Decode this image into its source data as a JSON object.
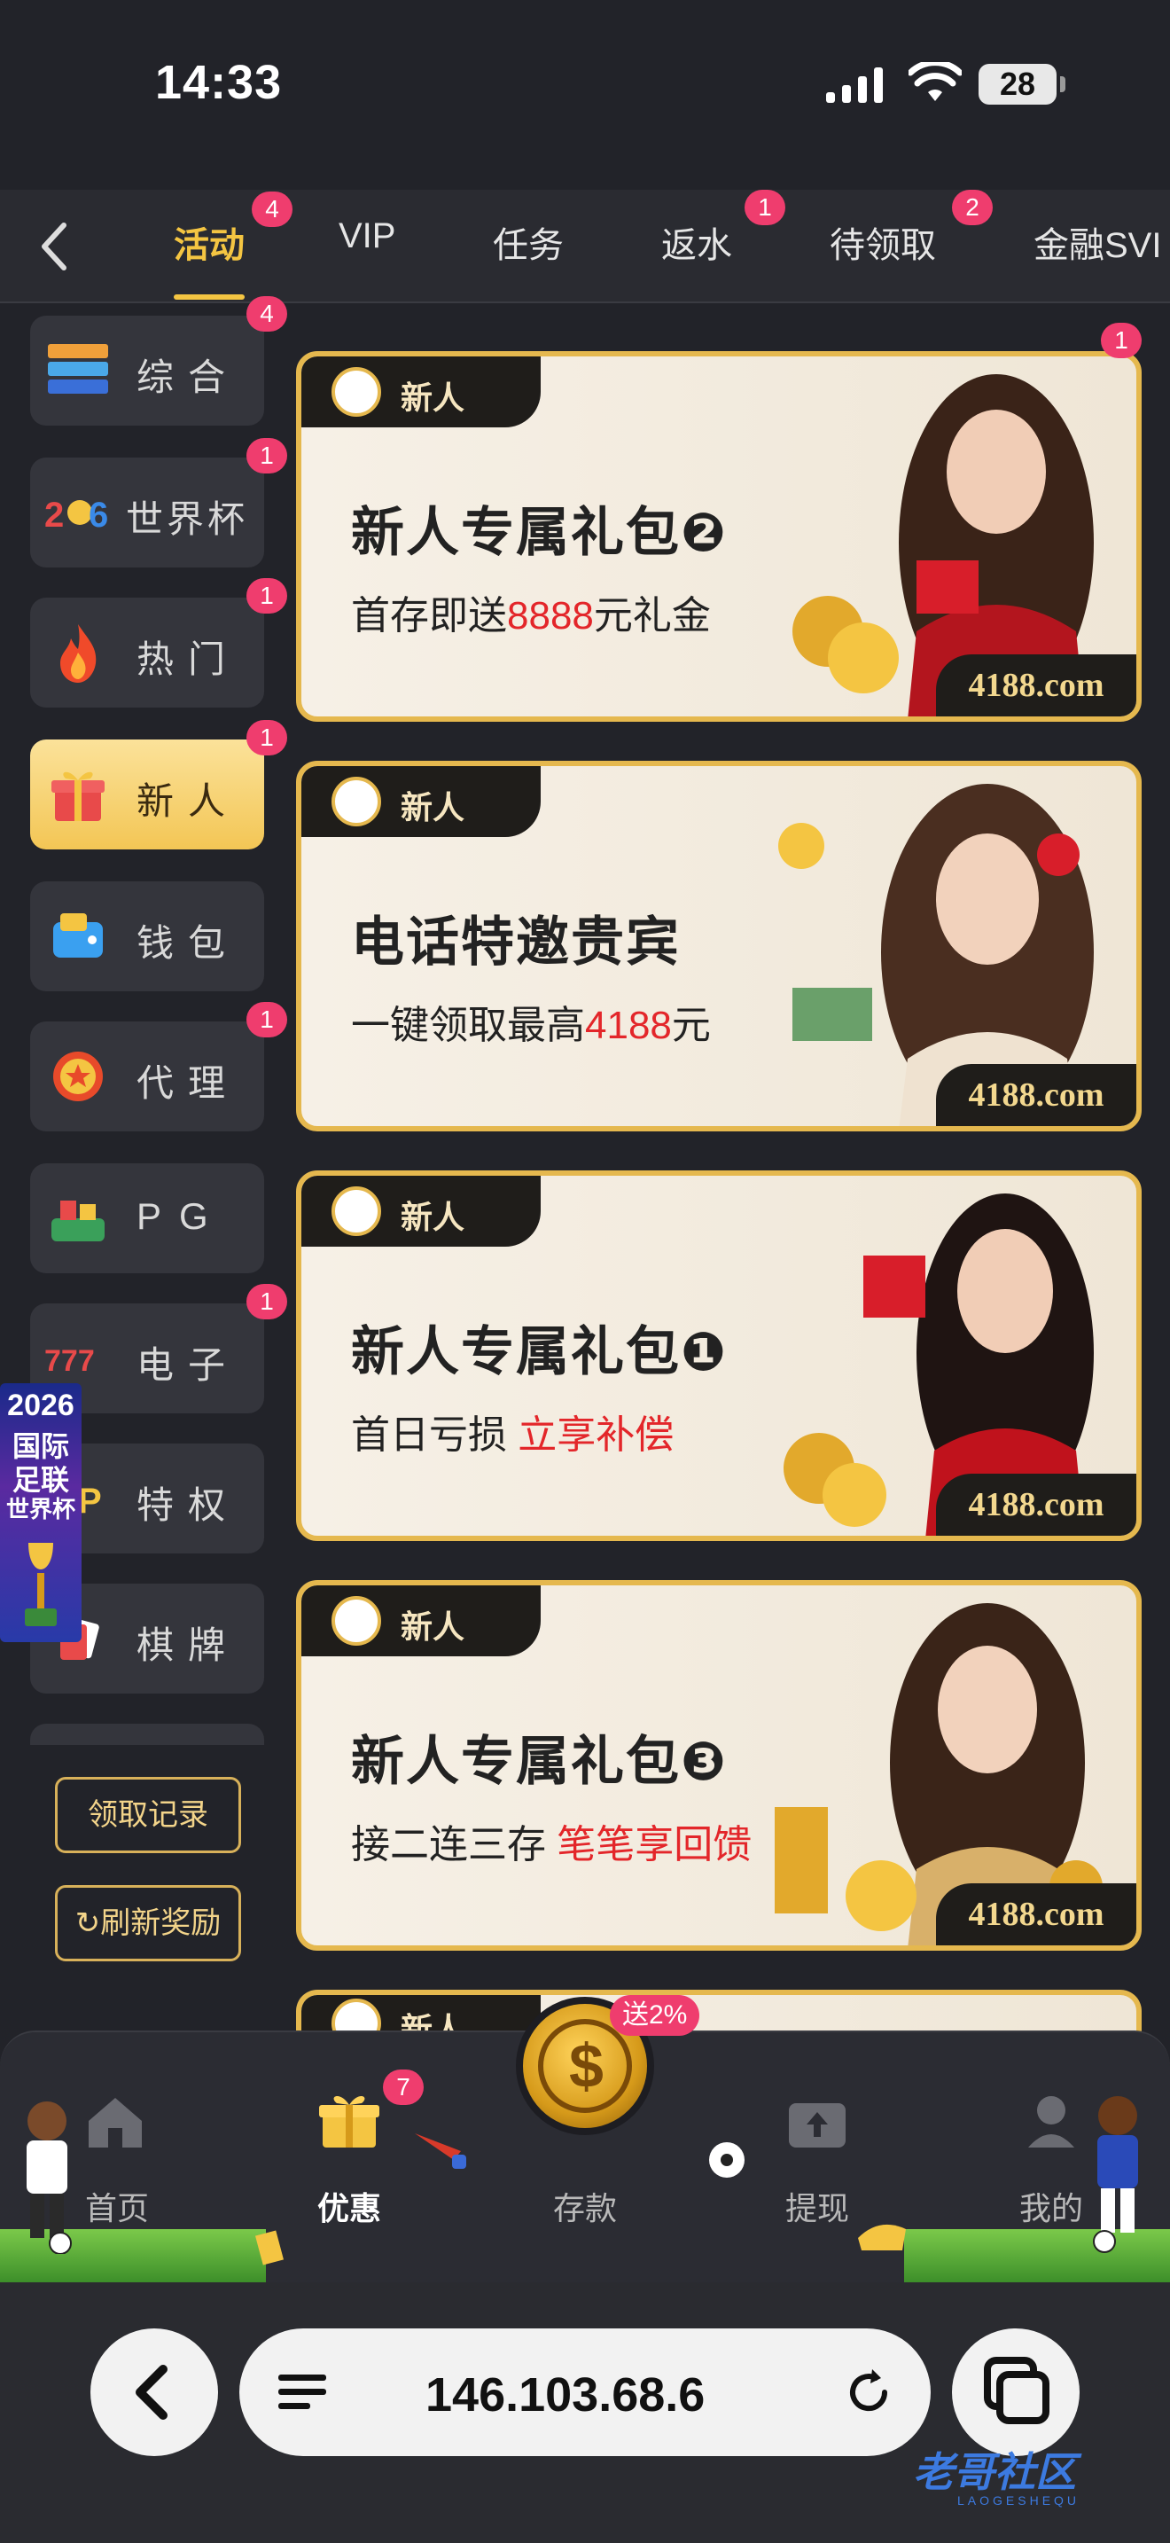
{
  "status": {
    "time": "14:33",
    "battery": "28"
  },
  "tabs": [
    {
      "label": "活动",
      "badge": "4"
    },
    {
      "label": "VIP",
      "badge": ""
    },
    {
      "label": "任务",
      "badge": ""
    },
    {
      "label": "返水",
      "badge": "1"
    },
    {
      "label": "待领取",
      "badge": "2"
    },
    {
      "label": "金融SVI",
      "badge": ""
    }
  ],
  "side": [
    {
      "label": "综合",
      "badge": "4",
      "icon": "layers-icon"
    },
    {
      "label": "世界杯",
      "badge": "1",
      "icon": "world-cup-icon"
    },
    {
      "label": "热门",
      "badge": "1",
      "icon": "fire-icon"
    },
    {
      "label": "新人",
      "badge": "1",
      "icon": "gift-icon"
    },
    {
      "label": "钱包",
      "badge": "",
      "icon": "wallet-icon"
    },
    {
      "label": "代理",
      "badge": "1",
      "icon": "agent-medal-icon"
    },
    {
      "label": "PG",
      "badge": "",
      "icon": "pg-icon"
    },
    {
      "label": "电子",
      "badge": "1",
      "icon": "slots-777-icon"
    },
    {
      "label": "特权",
      "badge": "",
      "icon": "vip-privilege-icon"
    },
    {
      "label": "棋牌",
      "badge": "",
      "icon": "cards-icon"
    }
  ],
  "side_buttons": {
    "records": "领取记录",
    "refresh": "刷新奖励"
  },
  "promo": {
    "year": "2026",
    "l1": "国际",
    "l2": "足联",
    "l3": "世界杯"
  },
  "cards": [
    {
      "tag": "新人",
      "title": "新人专属礼包❷",
      "sub_pre": "首存即送",
      "sub_hl": "8888",
      "sub_post": "元礼金",
      "site": "4188.com",
      "badge": "1"
    },
    {
      "tag": "新人",
      "title": "电话特邀贵宾",
      "sub_pre": "一键领取最高",
      "sub_hl": "4188",
      "sub_post": "元",
      "site": "4188.com",
      "badge": ""
    },
    {
      "tag": "新人",
      "title": "新人专属礼包❶",
      "sub_pre": "首日亏损 ",
      "sub_hl": "立享补偿",
      "sub_post": "",
      "site": "4188.com",
      "badge": ""
    },
    {
      "tag": "新人",
      "title": "新人专属礼包❸",
      "sub_pre": "接二连三存 ",
      "sub_hl": "笔笔享回馈",
      "sub_post": "",
      "site": "4188.com",
      "badge": ""
    },
    {
      "tag": "新人"
    }
  ],
  "nav": {
    "home": "首页",
    "promo": "优惠",
    "promo_badge": "7",
    "deposit": "存款",
    "deposit_pill": "送2%",
    "withdraw": "提现",
    "mine": "我的"
  },
  "browser": {
    "url": "146.103.68.6"
  },
  "watermark": {
    "text": "老哥社区",
    "sub": "LAOGESHEQU"
  },
  "colors": {
    "accent": "#f4c542",
    "badge": "#ef3d6e",
    "highlight": "#e3262a"
  }
}
